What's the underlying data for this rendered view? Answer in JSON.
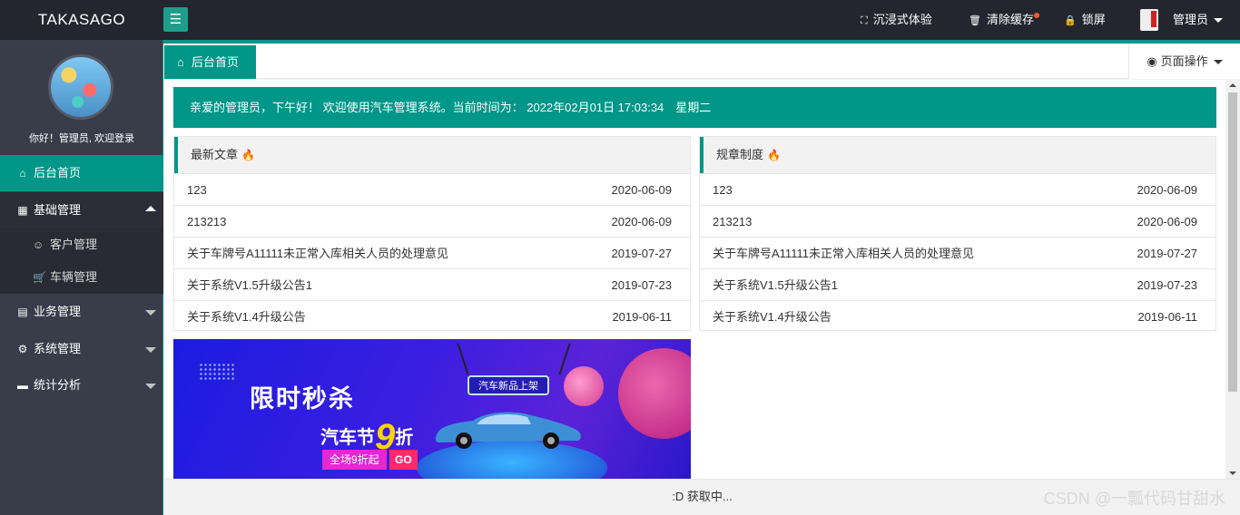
{
  "header": {
    "logo": "TAKASAGO",
    "menu_icon": "hamburger-icon",
    "immersive": "沉浸式体验",
    "clear_cache": "清除缓存",
    "lock": "锁屏",
    "admin": "管理员"
  },
  "sidebar": {
    "welcome": "你好！管理员, 欢迎登录",
    "items": [
      {
        "label": "后台首页",
        "icon": "home-icon"
      },
      {
        "label": "基础管理",
        "icon": "grid-icon"
      },
      {
        "label": "客户管理",
        "icon": "user-icon"
      },
      {
        "label": "车辆管理",
        "icon": "cart-icon"
      },
      {
        "label": "业务管理",
        "icon": "book-icon"
      },
      {
        "label": "系统管理",
        "icon": "gear-icon"
      },
      {
        "label": "统计分析",
        "icon": "monitor-icon"
      }
    ]
  },
  "tabs": {
    "home": "后台首页",
    "page_ops": "页面操作"
  },
  "notice": "亲爱的管理员，下午好！ 欢迎使用汽车管理系统。当前时间为： 2022年02月01日 17:03:34　星期二",
  "panels": [
    {
      "title": "最新文章",
      "rows": [
        {
          "title": "123",
          "date": "2020-06-09"
        },
        {
          "title": "213213",
          "date": "2020-06-09"
        },
        {
          "title": "关于车牌号A11111未正常入库相关人员的处理意见",
          "date": "2019-07-27"
        },
        {
          "title": "关于系统V1.5升级公告1",
          "date": "2019-07-23"
        },
        {
          "title": "关于系统V1.4升级公告",
          "date": "2019-06-11"
        }
      ]
    },
    {
      "title": "规章制度",
      "rows": [
        {
          "title": "123",
          "date": "2020-06-09"
        },
        {
          "title": "213213",
          "date": "2020-06-09"
        },
        {
          "title": "关于车牌号A11111未正常入库相关人员的处理意见",
          "date": "2019-07-27"
        },
        {
          "title": "关于系统V1.5升级公告1",
          "date": "2019-07-23"
        },
        {
          "title": "关于系统V1.4升级公告",
          "date": "2019-06-11"
        }
      ]
    }
  ],
  "promo": {
    "title": "限时秒杀",
    "sub_prefix": "汽车节",
    "sub_number": "9",
    "sub_suffix": "折",
    "pill": "全场9折起",
    "go": "GO",
    "tag": "汽车新品上架"
  },
  "footer": ":D 获取中...",
  "watermark": "CSDN @一瓢代码甘甜水",
  "colors": {
    "accent": "#009688",
    "header_bg": "#23262e",
    "sidebar_bg": "#393d49"
  }
}
